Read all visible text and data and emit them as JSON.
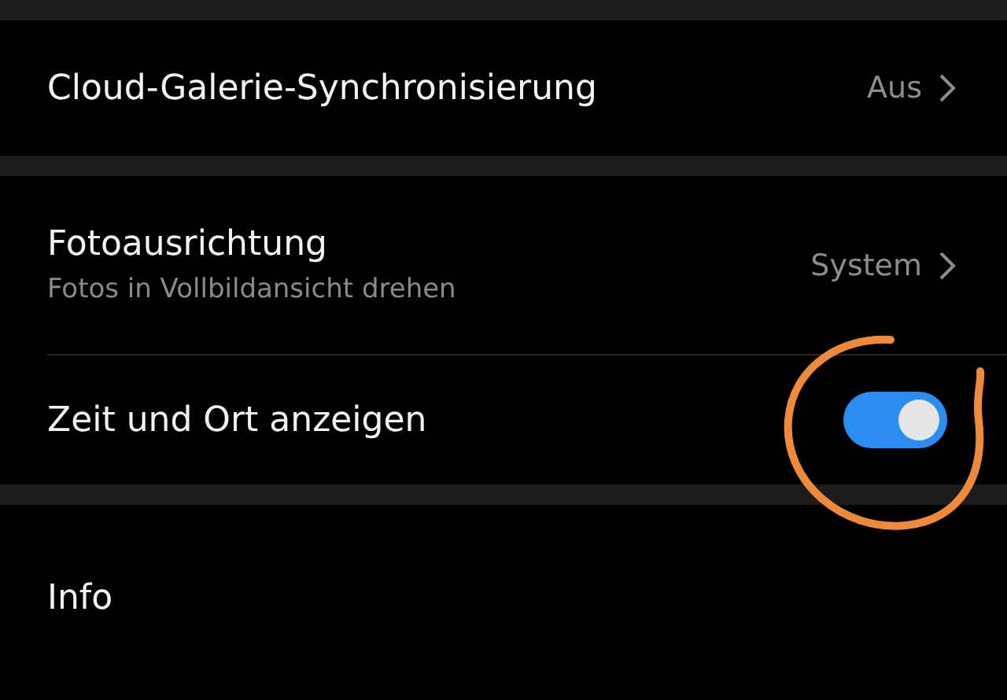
{
  "sections": [
    {
      "rows": [
        {
          "kind": "link",
          "title": "Cloud-Galerie-Synchronisierung",
          "value": "Aus"
        }
      ]
    },
    {
      "rows": [
        {
          "kind": "link",
          "title": "Fotoausrichtung",
          "subtitle": "Fotos in Vollbildansicht drehen",
          "value": "System"
        },
        {
          "kind": "switch",
          "title": "Zeit und Ort anzeigen",
          "on": true
        }
      ]
    },
    {
      "rows": [
        {
          "kind": "plain",
          "title": "Info"
        }
      ]
    }
  ]
}
